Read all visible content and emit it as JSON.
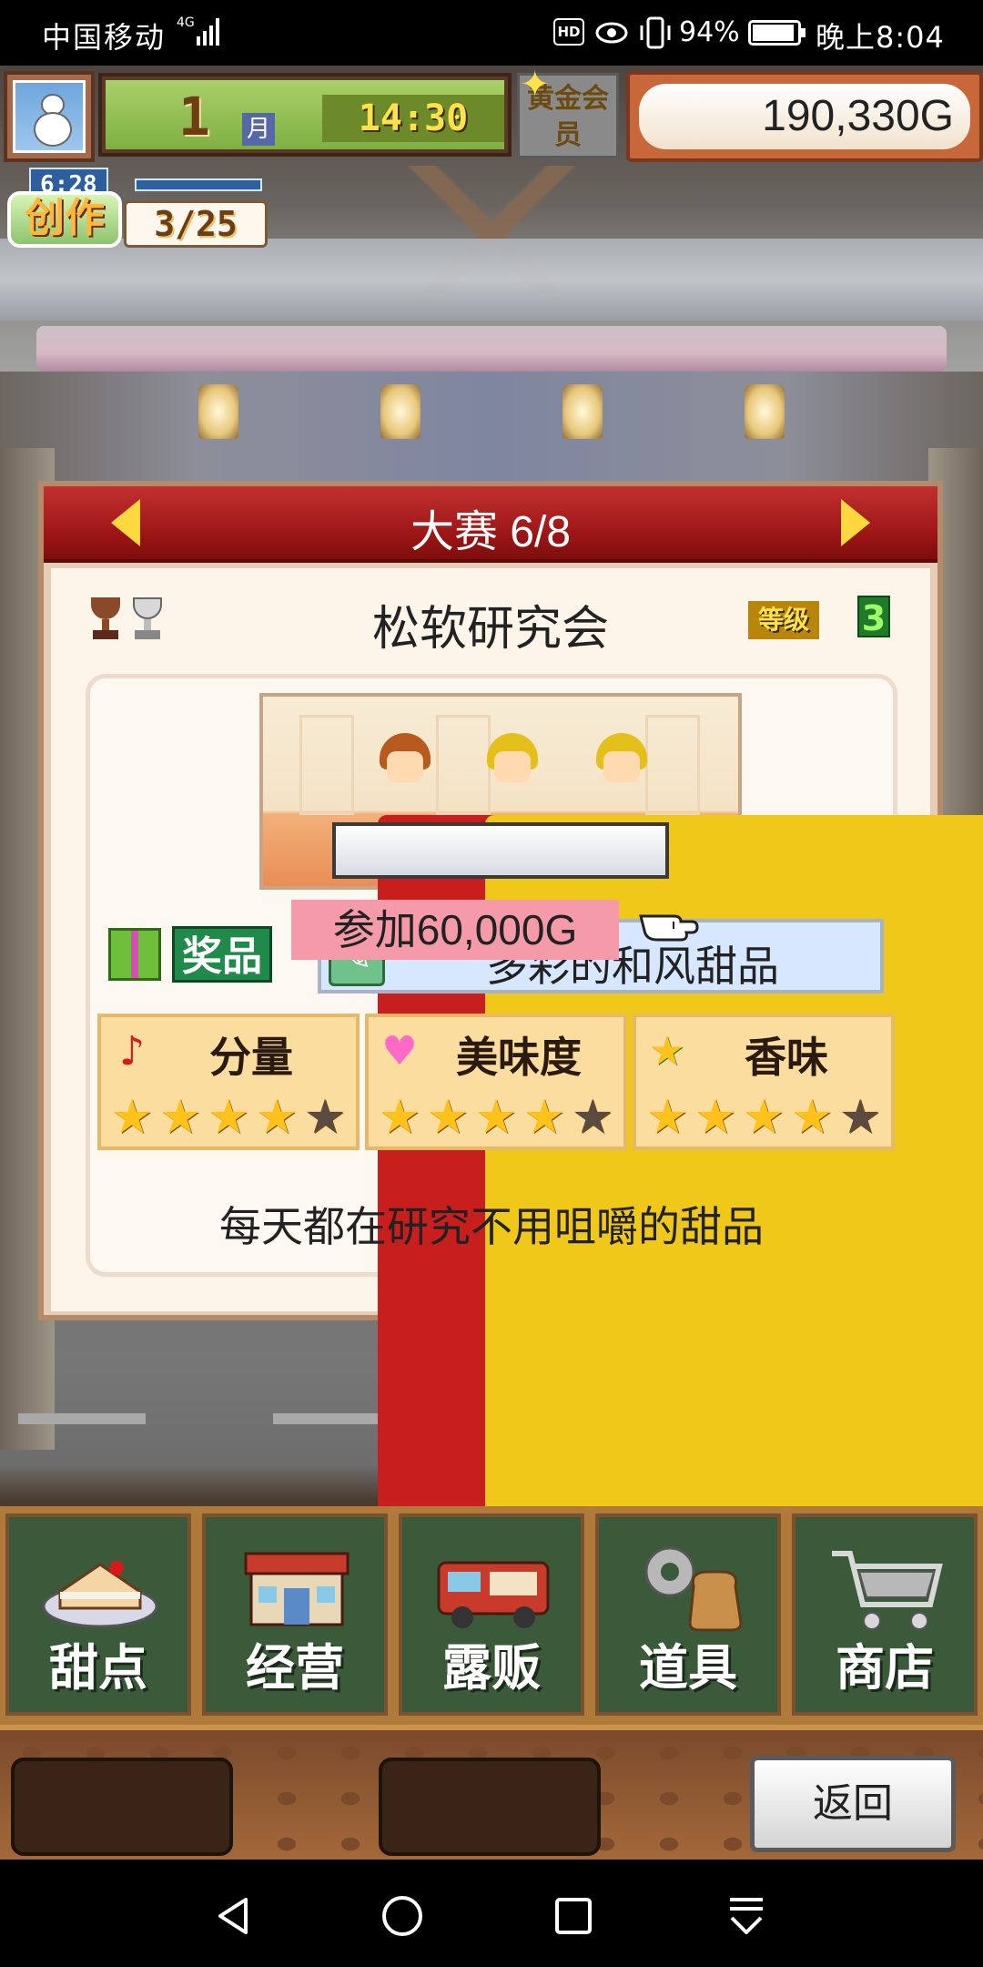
{
  "status_bar": {
    "carrier": "中国移动",
    "network": "4G",
    "battery_percent": "94%",
    "battery_level": 0.94,
    "time": "晚上8:04"
  },
  "hud": {
    "month_number": "1",
    "month_label": "月",
    "clock": "14:30",
    "membership_label": "黄金会员",
    "money": "190,330",
    "currency": "G",
    "create_label": "创作",
    "create_timer": "6:28",
    "create_count": "3/25"
  },
  "contest": {
    "header_title": "大赛 6/8",
    "name": "松软研究会",
    "grade_label": "等级",
    "grade_value": "3",
    "prize_label": "奖品",
    "prize_name": "多彩的和风甜品",
    "attributes": [
      {
        "icon": "note-icon",
        "label": "分量",
        "stars_filled": 4,
        "stars_total": 5
      },
      {
        "icon": "heart-icon",
        "label": "美味度",
        "stars_filled": 4,
        "stars_total": 5
      },
      {
        "icon": "star-icon",
        "label": "香味",
        "stars_filled": 4,
        "stars_total": 5
      }
    ],
    "description": "每天都在研究不用咀嚼的甜品",
    "join_label": "参加60,000G"
  },
  "menu": {
    "items": [
      {
        "label": "甜点"
      },
      {
        "label": "经营"
      },
      {
        "label": "露贩"
      },
      {
        "label": "道具"
      },
      {
        "label": "商店"
      }
    ]
  },
  "footer": {
    "back_label": "返回"
  },
  "colors": {
    "header_red": "#9a1414",
    "star_gold": "#ffc21a",
    "star_empty": "#5a4a40",
    "join_pink": "#f49aa8",
    "menu_green": "#3a5a3a"
  }
}
